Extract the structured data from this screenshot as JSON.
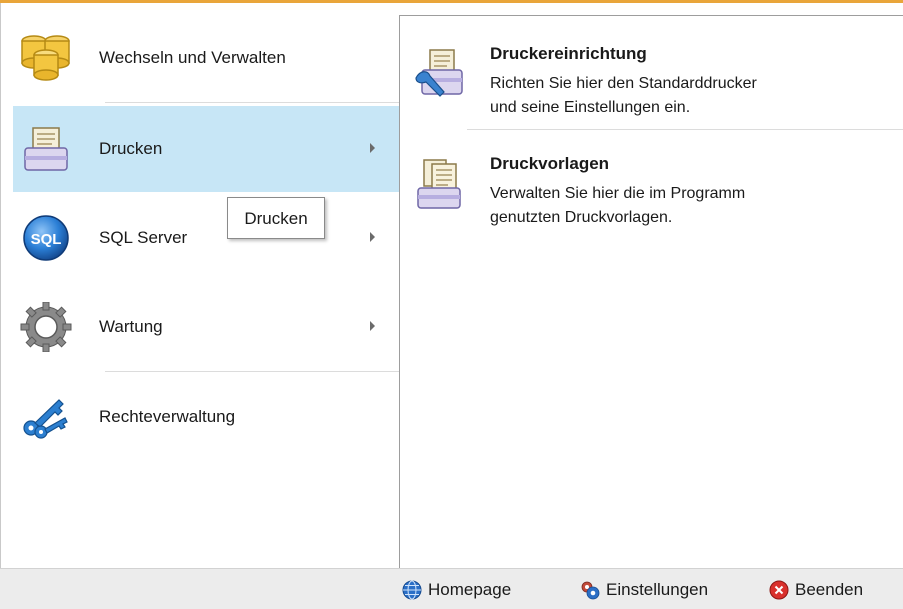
{
  "menu": {
    "items": [
      {
        "label": "Wechseln und Verwalten",
        "icon": "database-stack-icon",
        "has_submenu": false
      },
      {
        "label": "Drucken",
        "icon": "printer-icon",
        "has_submenu": true,
        "active": true
      },
      {
        "label": "SQL Server",
        "icon": "sql-icon",
        "has_submenu": true
      },
      {
        "label": "Wartung",
        "icon": "gear-icon",
        "has_submenu": true
      },
      {
        "label": "Rechteverwaltung",
        "icon": "keys-icon",
        "has_submenu": false
      }
    ],
    "tooltip": "Drucken"
  },
  "submenu": {
    "items": [
      {
        "title": "Druckereinrichtung",
        "desc_line1": "Richten Sie hier den Standarddrucker",
        "desc_line2": "und seine Einstellungen ein.",
        "icon": "printer-setup-icon"
      },
      {
        "title": "Druckvorlagen",
        "desc_line1": "Verwalten Sie hier die im Programm",
        "desc_line2": "genutzten Druckvorlagen.",
        "icon": "print-templates-icon"
      }
    ]
  },
  "footer": {
    "homepage": "Homepage",
    "settings": "Einstellungen",
    "exit": "Beenden"
  },
  "colors": {
    "accent_top": "#e9a53a",
    "active_bg": "#c7e6f6",
    "footer_bg": "#ececec"
  }
}
